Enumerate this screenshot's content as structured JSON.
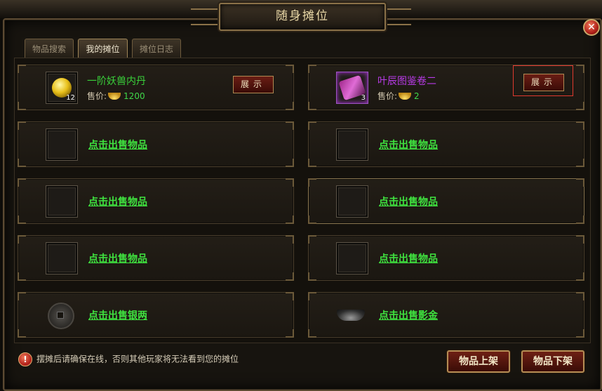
{
  "window": {
    "title": "随身摊位"
  },
  "close": {
    "glyph": "✕"
  },
  "tabs": [
    {
      "label": "物品搜索"
    },
    {
      "label": "我的摊位"
    },
    {
      "label": "摊位日志"
    }
  ],
  "left_slots": [
    {
      "type": "item",
      "name": "一阶妖兽内丹",
      "qty": "12",
      "price_label": "售价:",
      "price": "1200",
      "button": "展示"
    },
    {
      "type": "empty",
      "link": "点击出售物品"
    },
    {
      "type": "empty",
      "link": "点击出售物品"
    },
    {
      "type": "empty",
      "link": "点击出售物品"
    },
    {
      "type": "currency",
      "link": "点击出售银两",
      "icon": "coin-icon"
    }
  ],
  "right_slots": [
    {
      "type": "item",
      "name": "叶辰图鉴卷二",
      "qty": "3",
      "price_label": "售价:",
      "price": "2",
      "button": "展示"
    },
    {
      "type": "empty",
      "link": "点击出售物品"
    },
    {
      "type": "empty",
      "link": "点击出售物品"
    },
    {
      "type": "empty",
      "link": "点击出售物品"
    },
    {
      "type": "currency",
      "link": "点击出售影金",
      "icon": "ingot-icon"
    }
  ],
  "footer": {
    "notice": "摆摊后请确保在线，否则其他玩家将无法看到您的摊位",
    "list_button": "物品上架",
    "unlist_button": "物品下架"
  }
}
